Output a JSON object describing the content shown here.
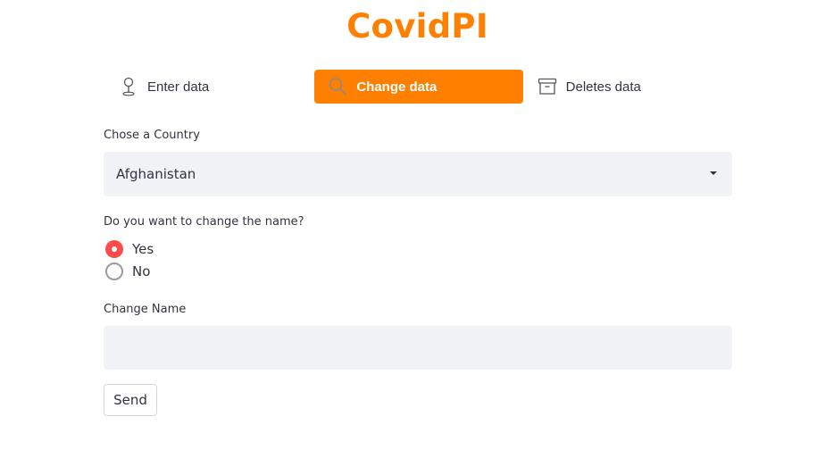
{
  "app": {
    "title": "CovidPI",
    "accent_color": "#ff8000"
  },
  "menu": {
    "items": [
      {
        "label": "Enter data",
        "icon": "map-pin-icon",
        "active": false
      },
      {
        "label": "Change data",
        "icon": "search-icon",
        "active": true
      },
      {
        "label": "Deletes data",
        "icon": "archive-icon",
        "active": false
      }
    ]
  },
  "country_select": {
    "label": "Chose a Country",
    "value": "Afghanistan"
  },
  "change_name_radio": {
    "label": "Do you want to change the name?",
    "options": [
      {
        "label": "Yes",
        "selected": true
      },
      {
        "label": "No",
        "selected": false
      }
    ],
    "selected_color": "#ff4b4b"
  },
  "change_name_input": {
    "label": "Change Name",
    "value": ""
  },
  "send_button": {
    "label": "Send"
  }
}
